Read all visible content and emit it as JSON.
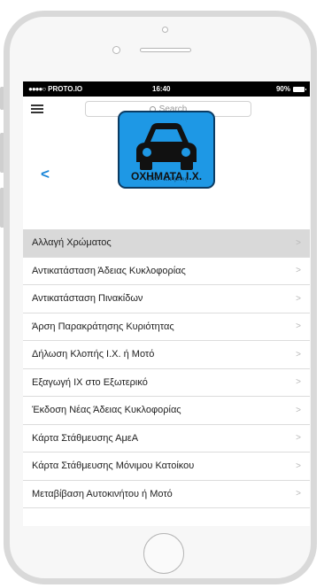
{
  "status_bar": {
    "carrier": "PROTO.IO",
    "time": "16:40",
    "battery": "90%"
  },
  "search": {
    "placeholder": "Search"
  },
  "header": {
    "logo_caption": "Αυτο - Κινήσεις",
    "title": "ΟΧΗΜΑΤΑ Ι.Χ."
  },
  "list": {
    "items": [
      {
        "label": "Αλλαγή Χρώματος",
        "active": true
      },
      {
        "label": "Αντικατάσταση Άδειας Κυκλοφορίας"
      },
      {
        "label": "Αντικατάσταση Πινακίδων"
      },
      {
        "label": "Άρση Παρακράτησης Κυριότητας"
      },
      {
        "label": "Δήλωση Κλοπής Ι.Χ. ή Μοτό"
      },
      {
        "label": "Εξαγωγή ΙΧ στο Εξωτερικό"
      },
      {
        "label": "Έκδοση Νέας Άδειας Κυκλοφορίας"
      },
      {
        "label": "Κάρτα Στάθμευσης ΑμεΑ"
      },
      {
        "label": "Κάρτα Στάθμευσης Μόνιμου Κατοίκου"
      },
      {
        "label": "Μεταβίβαση Αυτοκινήτου ή Μοτό"
      }
    ]
  },
  "icons": {
    "menu": "hamburger-menu-icon",
    "search": "search-icon",
    "back": "chevron-left-icon",
    "row": "chevron-right-icon",
    "logo": "car-icon"
  },
  "colors": {
    "accent": "#1a86d9",
    "logo_bg": "#1e98e5",
    "active_row": "#d9d9d9"
  }
}
